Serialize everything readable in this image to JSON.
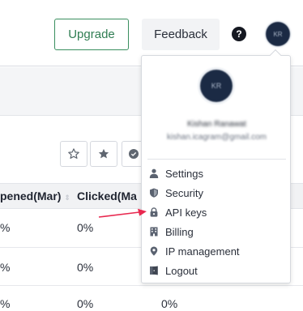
{
  "header": {
    "upgrade_label": "Upgrade",
    "feedback_label": "Feedback",
    "help_glyph": "?",
    "avatar_initials": "KR"
  },
  "toolbar": {
    "icons": [
      "star-outline-icon",
      "star-filled-icon",
      "check-circle-icon"
    ]
  },
  "table": {
    "columns": [
      "pened(Mar)",
      "Clicked(Ma"
    ],
    "rows": [
      [
        "%",
        "0%",
        ""
      ],
      [
        "%",
        "0%",
        ""
      ],
      [
        "%",
        "0%",
        "0%"
      ]
    ]
  },
  "user_menu": {
    "avatar_initials": "KR",
    "name": "Kishan Ranawat",
    "email": "kishan.icagram@gmail.com",
    "items": [
      {
        "label": "Settings",
        "icon": "user-icon"
      },
      {
        "label": "Security",
        "icon": "shield-icon"
      },
      {
        "label": "API keys",
        "icon": "lock-icon"
      },
      {
        "label": "Billing",
        "icon": "building-icon"
      },
      {
        "label": "IP management",
        "icon": "location-pin-icon"
      },
      {
        "label": "Logout",
        "icon": "logout-icon"
      }
    ]
  },
  "colors": {
    "upgrade_green": "#2f7d52",
    "annotation_red": "#e8284f",
    "avatar_navy": "#1b2a44"
  }
}
